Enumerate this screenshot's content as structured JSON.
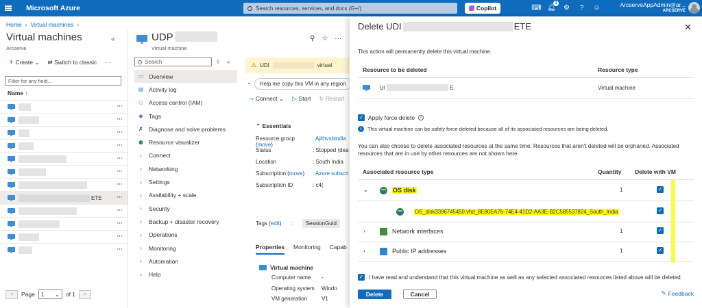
{
  "topbar": {
    "brand": "Microsoft Azure",
    "search_placeholder": "Search resources, services, and docs (G+/)",
    "copilot": "Copilot",
    "notifications_count": "1",
    "user_name": "ArcserveAppAdmin@ar...",
    "user_org": "ARCSERVE",
    "accent": "#0f6cbd"
  },
  "breadcrumb": [
    "Home",
    "Virtual machines"
  ],
  "left_panel": {
    "title": "Virtual machines",
    "subtitle": "Arcserve",
    "create": "Create",
    "switch": "Switch to classic",
    "filter_placeholder": "Filter for any field...",
    "col_name": "Name",
    "selected_row_suffix": "ETE",
    "pager": {
      "page_label": "Page",
      "page_value": "1",
      "of_label": "of 1"
    }
  },
  "middle_panel": {
    "title_prefix": "UDP",
    "subtitle": "Virtual machine",
    "search_placeholder": "Search",
    "menu": [
      {
        "label": "Overview",
        "icon": "monitor-icon",
        "expandable": false
      },
      {
        "label": "Activity log",
        "icon": "log-icon",
        "expandable": false
      },
      {
        "label": "Access control (IAM)",
        "icon": "people-icon",
        "expandable": false
      },
      {
        "label": "Tags",
        "icon": "tag-icon",
        "expandable": false
      },
      {
        "label": "Diagnose and solve problems",
        "icon": "wrench-icon",
        "expandable": false
      },
      {
        "label": "Resource visualizer",
        "icon": "visualizer-icon",
        "expandable": false
      },
      {
        "label": "Connect",
        "expandable": true
      },
      {
        "label": "Networking",
        "expandable": true
      },
      {
        "label": "Settings",
        "expandable": true
      },
      {
        "label": "Availability + scale",
        "expandable": true
      },
      {
        "label": "Security",
        "expandable": true
      },
      {
        "label": "Backup + disaster recovery",
        "expandable": true
      },
      {
        "label": "Operations",
        "expandable": true
      },
      {
        "label": "Monitoring",
        "expandable": true
      },
      {
        "label": "Automation",
        "expandable": true
      },
      {
        "label": "Help",
        "expandable": true
      }
    ],
    "warning": {
      "prefix": "UDI",
      "suffix": "virtual"
    },
    "help_text": "Help me copy this VM in any region",
    "commands": {
      "connect": "Connect",
      "start": "Start",
      "restart": "Restart"
    },
    "essentials": {
      "heading": "Essentials",
      "rows": [
        {
          "k": "Resource group",
          "link": "move",
          "v": "Ajithvsbindia"
        },
        {
          "k": "Status",
          "v": "Stopped (dea"
        },
        {
          "k": "Location",
          "v": "South India"
        },
        {
          "k": "Subscription",
          "link": "move",
          "v": "Azure subscri"
        },
        {
          "k": "Subscription ID",
          "v": "c4("
        }
      ]
    },
    "tags": {
      "label": "Tags",
      "edit": "edit",
      "value": "SessionGuid"
    },
    "tabs": [
      "Properties",
      "Monitoring",
      "Capab"
    ],
    "vm_section": {
      "heading": "Virtual machine",
      "rows": [
        {
          "k": "Computer name",
          "v": "-"
        },
        {
          "k": "Operating system",
          "v": "Windo"
        },
        {
          "k": "VM generation",
          "v": "V1"
        }
      ]
    }
  },
  "dialog": {
    "title_prefix": "Delete UDI",
    "title_suffix": "ETE",
    "warning": "This action will permanently delete this virtual machine.",
    "col_resource": "Resource to be deleted",
    "col_type": "Resource type",
    "resource_prefix": "UI",
    "resource_suffix": "E",
    "resource_type": "Virtual machine",
    "force_label": "Apply force delete",
    "force_info": "This virtual machine can be safely force deleted because all of its associated resources are being deleted.",
    "orphan_text": "You can also choose to delete associated resources at the same time. Resources that aren't deleted will be orphaned. Associated resources that are in use by other resources are not shown here.",
    "assoc_cols": {
      "type": "Associated resource type",
      "quantity": "Quantity",
      "delete": "Delete with VM"
    },
    "assoc_rows": [
      {
        "label": "OS disk",
        "qty": "1",
        "expanded": true,
        "icon": "disk-icon",
        "highlight": true
      },
      {
        "label": "OS_disk3396745450.vhd_8E80EA76-74E4-41D2-AA3E-B2C585537824_South_India",
        "child": true,
        "icon": "disk-icon",
        "highlight": true
      },
      {
        "label": "Network interfaces",
        "qty": "1",
        "icon": "network-icon"
      },
      {
        "label": "Public IP addresses",
        "qty": "1",
        "icon": "public-ip-icon"
      }
    ],
    "ack": "I have read and understand that this virtual machine as well as any selected associated resources listed above will be deleted.",
    "delete_btn": "Delete",
    "cancel_btn": "Cancel",
    "feedback": "Feedback",
    "highlight_color": "#ffff00"
  }
}
